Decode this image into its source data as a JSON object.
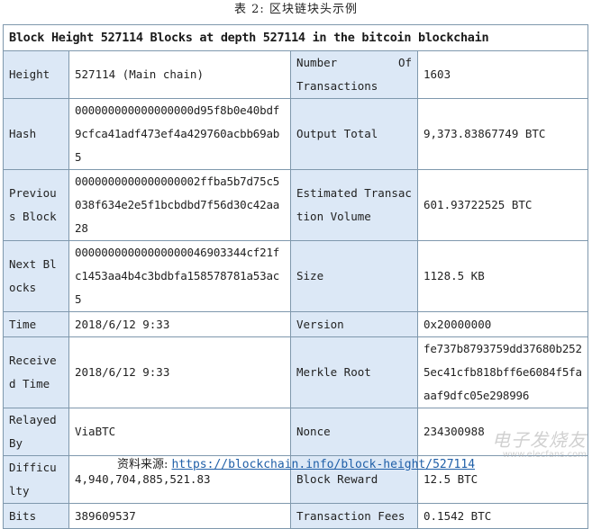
{
  "caption": "表 2: 区块链块头示例",
  "table": {
    "title": "Block Height 527114 Blocks at depth 527114 in the bitcoin blockchain",
    "rows": [
      {
        "left_key": "Height",
        "left_value": "527114 (Main chain)",
        "right_key_parts": [
          "Number",
          "Of",
          "Transactions"
        ],
        "right_value": "1603"
      },
      {
        "left_key": "Hash",
        "left_value": "000000000000000000d95f8b0e40bdf9cfca41adf473ef4a429760acbb69ab5",
        "right_key": "Output Total",
        "right_value": "9,373.83867749 BTC"
      },
      {
        "left_key": "Previous Block",
        "left_value": "0000000000000000002ffba5b7d75c5038f634e2e5f1bcbdbd7f56d30c42aa28",
        "right_key": "Estimated Transaction Volume",
        "right_value": "601.93722525 BTC"
      },
      {
        "left_key": "Next Blocks",
        "left_value": "00000000000000000046903344cf21fc1453aa4b4c3bdbfa158578781a53ac5",
        "right_key": "Size",
        "right_value": "1128.5 KB"
      },
      {
        "left_key": "Time",
        "left_value": "2018/6/12 9:33",
        "right_key": "Version",
        "right_value": "0x20000000"
      },
      {
        "left_key": "Received Time",
        "left_value": "2018/6/12 9:33",
        "right_key": "Merkle Root",
        "right_value": "fe737b8793759dd37680b2525ec41cfb818bff6e6084f5faaaf9dfc05e298996"
      },
      {
        "left_key": "Relayed By",
        "left_value": "ViaBTC",
        "right_key": "Nonce",
        "right_value": "234300988"
      },
      {
        "left_key": "Difficulty",
        "left_value": "4,940,704,885,521.83",
        "right_key": "Block Reward",
        "right_value": "12.5 BTC"
      },
      {
        "left_key": "Bits",
        "left_value": "389609537",
        "right_key": "Transaction Fees",
        "right_value": "0.1542 BTC"
      }
    ]
  },
  "source": {
    "label": "资料来源: ",
    "link_text": "https://blockchain.info/block-height/527114"
  },
  "watermark": {
    "logo": "电子发烧友",
    "url": "www.elecfans.com"
  },
  "colors": {
    "key_cell_bg": "#dce8f6",
    "border": "#7f98ad",
    "link": "#1f5fa8"
  }
}
